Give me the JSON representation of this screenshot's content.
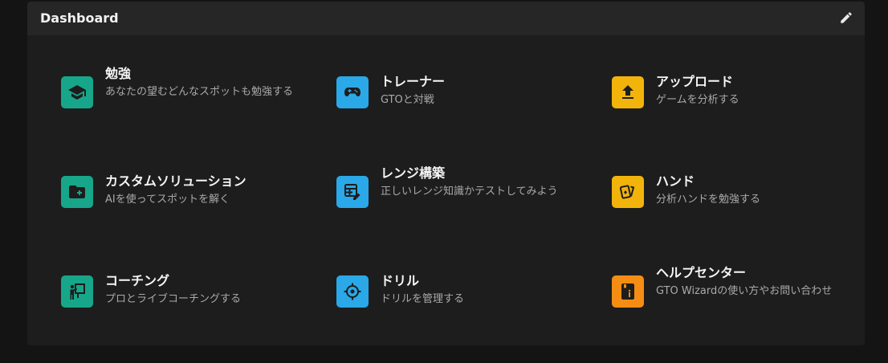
{
  "header": {
    "title": "Dashboard"
  },
  "colors": {
    "green": "#17a689",
    "blue": "#2aa8e8",
    "yellow": "#f2b40a",
    "orange": "#f58d14"
  },
  "tiles": [
    {
      "title": "勉強",
      "desc": "あなたの望むどんなスポットも勉強する",
      "icon": "graduation-cap-icon",
      "color": "#17a689"
    },
    {
      "title": "トレーナー",
      "desc": "GTOと対戦",
      "icon": "gamepad-icon",
      "color": "#2aa8e8"
    },
    {
      "title": "アップロード",
      "desc": "ゲームを分析する",
      "icon": "upload-icon",
      "color": "#f2b40a"
    },
    {
      "title": "カスタムソリューション",
      "desc": "AIを使ってスポットを解く",
      "icon": "folder-plus-icon",
      "color": "#17a689"
    },
    {
      "title": "レンジ構築",
      "desc": "正しいレンジ知識かテストしてみよう",
      "icon": "range-builder-icon",
      "color": "#2aa8e8"
    },
    {
      "title": "ハンド",
      "desc": "分析ハンドを勉強する",
      "icon": "cards-icon",
      "color": "#f2b40a"
    },
    {
      "title": "コーチング",
      "desc": "プロとライブコーチングする",
      "icon": "coach-icon",
      "color": "#17a689"
    },
    {
      "title": "ドリル",
      "desc": "ドリルを管理する",
      "icon": "crosshair-icon",
      "color": "#2aa8e8"
    },
    {
      "title": "ヘルプセンター",
      "desc": "GTO Wizardの使い方やお問い合わせ",
      "icon": "help-book-icon",
      "color": "#f58d14"
    }
  ]
}
